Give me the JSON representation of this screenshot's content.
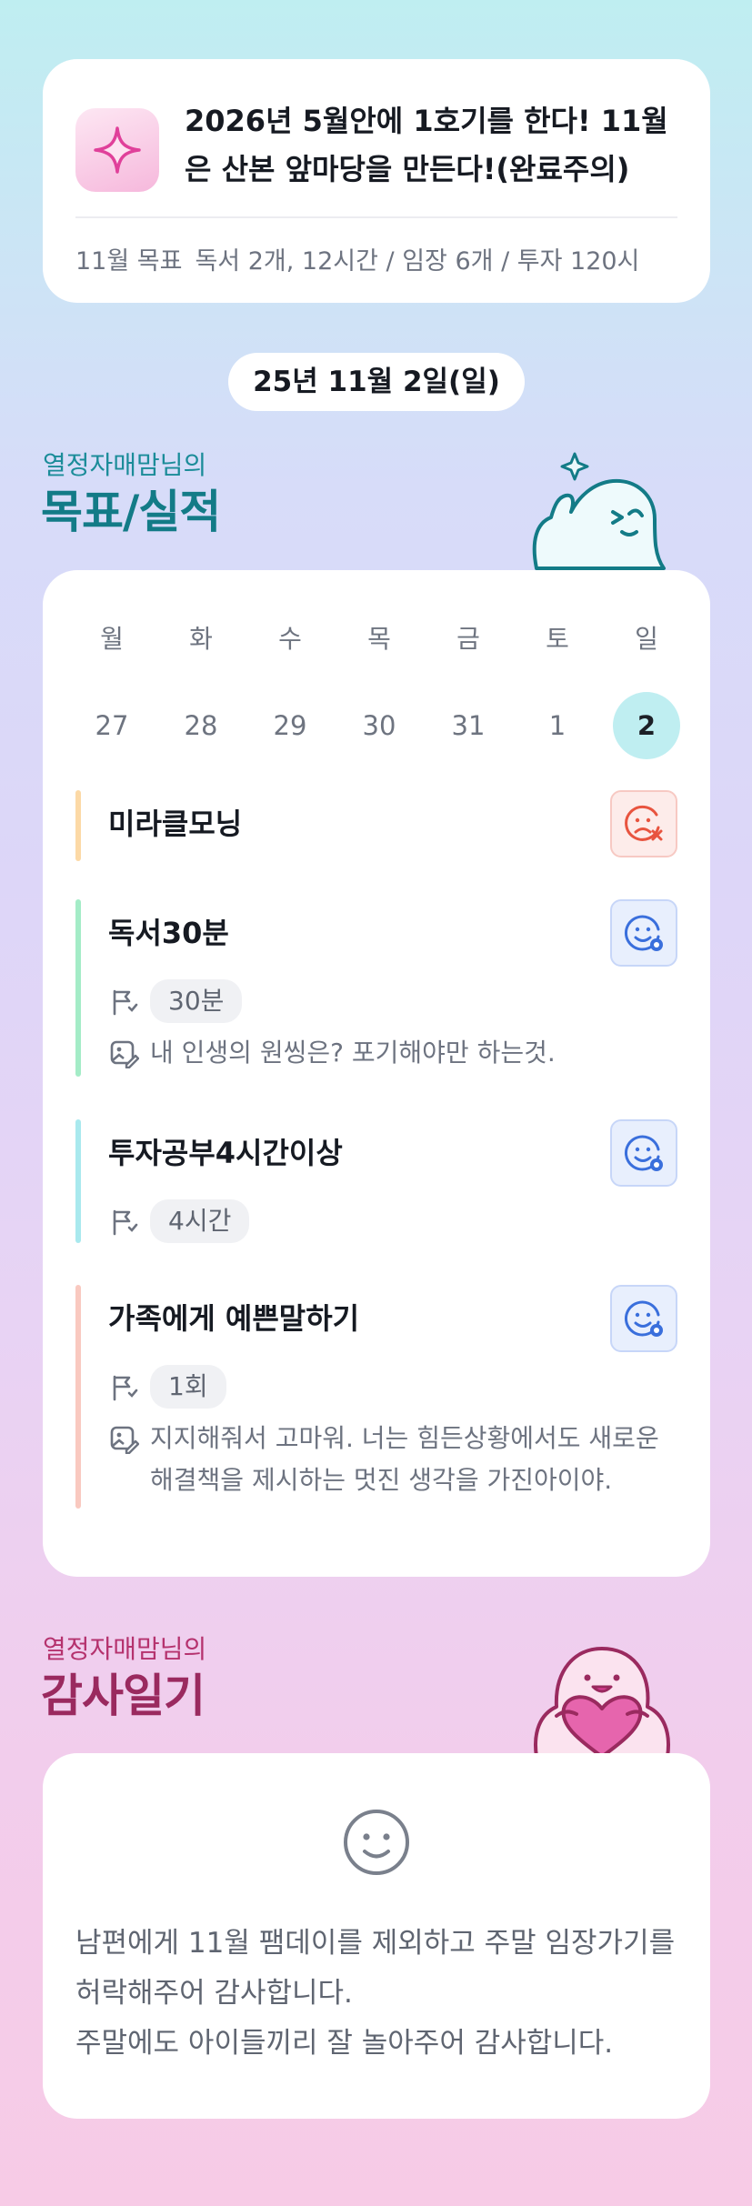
{
  "goal": {
    "icon": "sparkle-icon",
    "title": "2026년 5월안에 1호기를 한다! 11월은 산본 앞마당을 만든다!(완료주의)",
    "sub_label": "11월 목표",
    "sub_text": "독서 2개, 12시간 / 임장 6개 / 투자 120시"
  },
  "date": "25년 11월 2일(일)",
  "section_goals": {
    "subtitle": "열정자매맘님의",
    "title": "목표/실적"
  },
  "calendar": {
    "days": [
      {
        "name": "월",
        "num": "27"
      },
      {
        "name": "화",
        "num": "28"
      },
      {
        "name": "수",
        "num": "29"
      },
      {
        "name": "목",
        "num": "30"
      },
      {
        "name": "금",
        "num": "31"
      },
      {
        "name": "토",
        "num": "1"
      },
      {
        "name": "일",
        "num": "2"
      }
    ],
    "selected_index": 6,
    "selected_color": "#bfeef1"
  },
  "tasks": [
    {
      "name": "미라클모닝",
      "status": "fail",
      "bar_color": "#fcd9a6"
    },
    {
      "name": "독서30분",
      "status": "done",
      "target": "30분",
      "memo": "내 인생의 원씽은? 포기해야만 하는것.",
      "bar_color": "#a4ecc7"
    },
    {
      "name": "투자공부4시간이상",
      "status": "done",
      "target": "4시간",
      "bar_color": "#a9e9ee"
    },
    {
      "name": "가족에게 예쁜말하기",
      "status": "done",
      "target": "1회",
      "memo": "지지해줘서 고마워. 너는 힘든상황에서도 새로운 해결책을 제시하는 멋진 생각을 가진아이야.",
      "bar_color": "#f9c9c0"
    }
  ],
  "section_diary": {
    "subtitle": "열정자매맘님의",
    "title": "감사일기"
  },
  "diary": {
    "icon": "smile-icon",
    "text": "남편에게 11월 팸데이를 제외하고 주말 임장가기를 허락해주어 감사합니다.\n주말에도 아이들끼리 잘 놀아주어 감사합니다."
  },
  "colors": {
    "teal": "#137b87",
    "pink": "#9a2a5f",
    "fail": "#e8543f",
    "done": "#3a6fdc"
  }
}
